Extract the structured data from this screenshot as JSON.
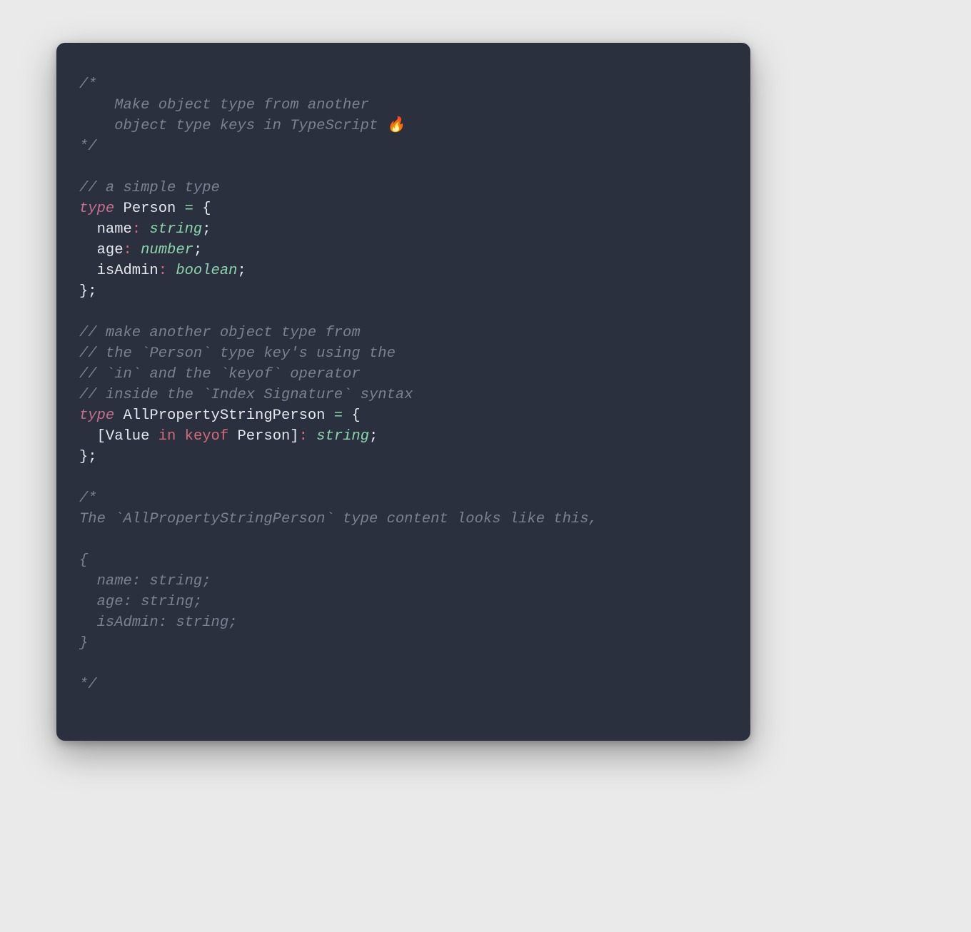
{
  "code": {
    "c1_l1": "/*",
    "c1_l2": "    Make object type from another",
    "c1_l3": "    object type keys in TypeScript 🔥",
    "c1_l4": "*/",
    "c2": "// a simple type",
    "k_type1": "type",
    "type_person": "Person",
    "eq": "=",
    "brace_open": " {",
    "p_name": "  name",
    "p_age": "  age",
    "p_isAdmin": "  isAdmin",
    "colon_sp": ": ",
    "t_string": "string",
    "t_number": "number",
    "t_boolean": "boolean",
    "semi": ";",
    "brace_close_semi": "};",
    "c3_l1": "// make another object type from",
    "c3_l2": "// the `Person` type key's using the",
    "c3_l3": "// `in` and the `keyof` operator",
    "c3_l4": "// inside the `Index Signature` syntax",
    "type_aps": "AllPropertyStringPerson",
    "bracket_open": "  [",
    "value": "Value",
    "kw_in": "in",
    "kw_keyof": "keyof",
    "person_ref": "Person",
    "bracket_close": "]",
    "c4_l1": "/*",
    "c4_l2": "The `AllPropertyStringPerson` type content looks like this,",
    "c4_l3": "",
    "c4_l4": "{",
    "c4_l5": "  name: string;",
    "c4_l6": "  age: string;",
    "c4_l7": "  isAdmin: string;",
    "c4_l8": "}",
    "c4_l9": "",
    "c4_l10": "*/"
  }
}
